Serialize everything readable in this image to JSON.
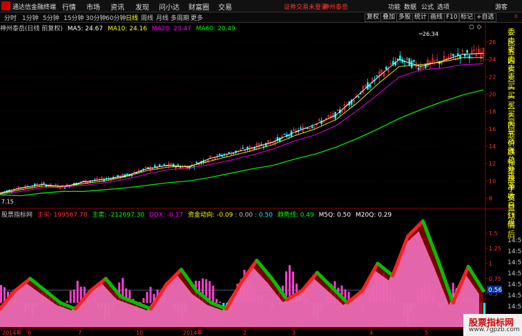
{
  "app": {
    "title": "通达信金融终端",
    "menu": [
      "行情",
      "市场",
      "资讯",
      "发现",
      "问小达",
      "财富圈",
      "交易"
    ],
    "login": "证券交易未登录",
    "stock_name": "神州泰岳",
    "right_menu": [
      "功能",
      "数据",
      "公式",
      "选项"
    ],
    "guest": "游客"
  },
  "toolbar": {
    "periods": [
      "分时",
      "1分钟",
      "5分钟",
      "15分钟",
      "30分钟",
      "60分钟",
      "日线",
      "周线",
      "月线",
      "多周期",
      "更多"
    ],
    "active_period": "日线",
    "right_buttons": [
      "复权",
      "叠加",
      "多股",
      "统计",
      "画线",
      "F10",
      "标记",
      "+自选"
    ],
    "zero_label": "0"
  },
  "main_legend": {
    "title": "神州泰岳(日线 前复权)",
    "ma5": "MA5: 24.67",
    "ma10": "MA10: 24.16",
    "ma20": "MA20: 23.47",
    "ma60": "MA60: 20.49"
  },
  "sub_legend": {
    "title": "股票指标网",
    "zhumai": "主买: 199567.78",
    "zhumai2": "主卖: -212697.30",
    "ddx": "DDX: -0.17",
    "zjdx": "资金动向: -0.09",
    "v1": ": 0.00",
    "v2": ": 0.50",
    "qsx": "趋势线: 0.49",
    "m5q": "M5Q: 0.50",
    "m20q": "M20Q: 0.29"
  },
  "side_labels": [
    "委比",
    "卖五",
    "卖四",
    "卖三",
    "卖二",
    "卖一",
    "买一",
    "买二",
    "买三",
    "买四",
    "买五",
    "现价",
    "涨跌",
    "涨幅",
    "总量",
    "外盘",
    "换手",
    "净资",
    "收益",
    "自动",
    "行情",
    "盘后"
  ],
  "side_times": [
    "14:50",
    "14:50",
    "14:50",
    "14:50",
    "14:50",
    "14:50",
    "14:50",
    "14:50"
  ],
  "watermark": {
    "line1": "股票指标网",
    "line2": "www.7gpzb.com"
  },
  "colors": {
    "up": "#ff3232",
    "down": "#00ffff",
    "ma5": "#ffffff",
    "ma10": "#ffff00",
    "ma20": "#ff00ff",
    "ma60": "#00ff00",
    "price_axis": "#ff3232",
    "pink_fill": "#ff7fd4",
    "dark_red_fill": "#8b0000",
    "green_band": "#00c000"
  },
  "chart_data": [
    {
      "type": "candlestick",
      "title": "神州泰岳(日线 前复权)",
      "y_ticks": [
        8.0,
        10.0,
        12.0,
        14.0,
        16.0,
        18.0,
        20.0,
        22.0,
        24.0,
        26.0
      ],
      "ylim": [
        7.0,
        27.2
      ],
      "x_labels": [
        "2014年",
        "6",
        "7",
        "10",
        "2014年",
        "2",
        "3",
        "4",
        "5"
      ],
      "annotations": {
        "high": "26.34",
        "low": "7.15"
      },
      "series": [
        {
          "name": "MA5",
          "values": [
            8.6,
            9.2,
            9.6,
            9.3,
            9.9,
            10.2,
            10.6,
            11.4,
            11.8,
            11.6,
            12.6,
            13.2,
            13.8,
            14.5,
            15.6,
            16.5,
            17.6,
            19.8,
            22.0,
            24.0,
            23.2,
            23.8,
            24.6,
            24.7
          ]
        },
        {
          "name": "MA10",
          "values": [
            8.5,
            9.0,
            9.4,
            9.4,
            9.7,
            10.0,
            10.5,
            11.2,
            11.6,
            11.7,
            12.3,
            12.9,
            13.5,
            14.2,
            15.2,
            16.0,
            17.1,
            19.0,
            21.2,
            23.2,
            23.4,
            23.7,
            24.2,
            24.2
          ]
        },
        {
          "name": "MA20",
          "values": [
            8.4,
            8.8,
            9.2,
            9.3,
            9.5,
            9.8,
            10.2,
            10.8,
            11.3,
            11.5,
            11.9,
            12.4,
            13.0,
            13.7,
            14.6,
            15.3,
            16.4,
            18.1,
            20.0,
            22.0,
            22.8,
            23.0,
            23.4,
            23.5
          ]
        },
        {
          "name": "MA60",
          "values": [
            8.4,
            8.3,
            8.6,
            8.8,
            8.8,
            9.0,
            9.2,
            9.5,
            9.8,
            10.0,
            10.4,
            10.9,
            11.4,
            11.8,
            12.5,
            13.1,
            13.9,
            14.9,
            16.0,
            17.2,
            18.2,
            19.1,
            19.9,
            20.5
          ]
        }
      ]
    },
    {
      "type": "bar",
      "title": "股票指标网",
      "y_ticks": [
        0.5,
        0.75,
        1.0,
        1.25,
        1.5
      ],
      "ylim": [
        -0.05,
        1.75
      ],
      "current_value": "0.56",
      "ddx_bars": [
        0.35,
        0.1,
        -0.2,
        0.2,
        -0.15,
        0.3,
        0.12,
        -0.25,
        0.4,
        -0.1,
        0.22,
        0.1,
        -0.3,
        0.45,
        0.25,
        -0.2,
        0.5,
        0.2,
        -0.15,
        0.6,
        0.1,
        -0.25,
        0.35,
        0.15,
        -0.1,
        0.55,
        0.15,
        -0.35,
        0.45,
        -0.1,
        0.3,
        0.1,
        -0.2
      ],
      "trend": [
        0.25,
        0.55,
        0.75,
        0.55,
        0.35,
        0.25,
        0.55,
        0.75,
        0.45,
        0.35,
        0.25,
        0.65,
        0.9,
        0.55,
        0.35,
        0.25,
        0.7,
        1.05,
        0.75,
        0.4,
        0.55,
        0.85,
        0.6,
        0.35,
        0.55,
        1.0,
        0.8,
        1.45,
        1.7,
        1.05,
        0.35,
        0.95,
        0.55
      ]
    }
  ]
}
